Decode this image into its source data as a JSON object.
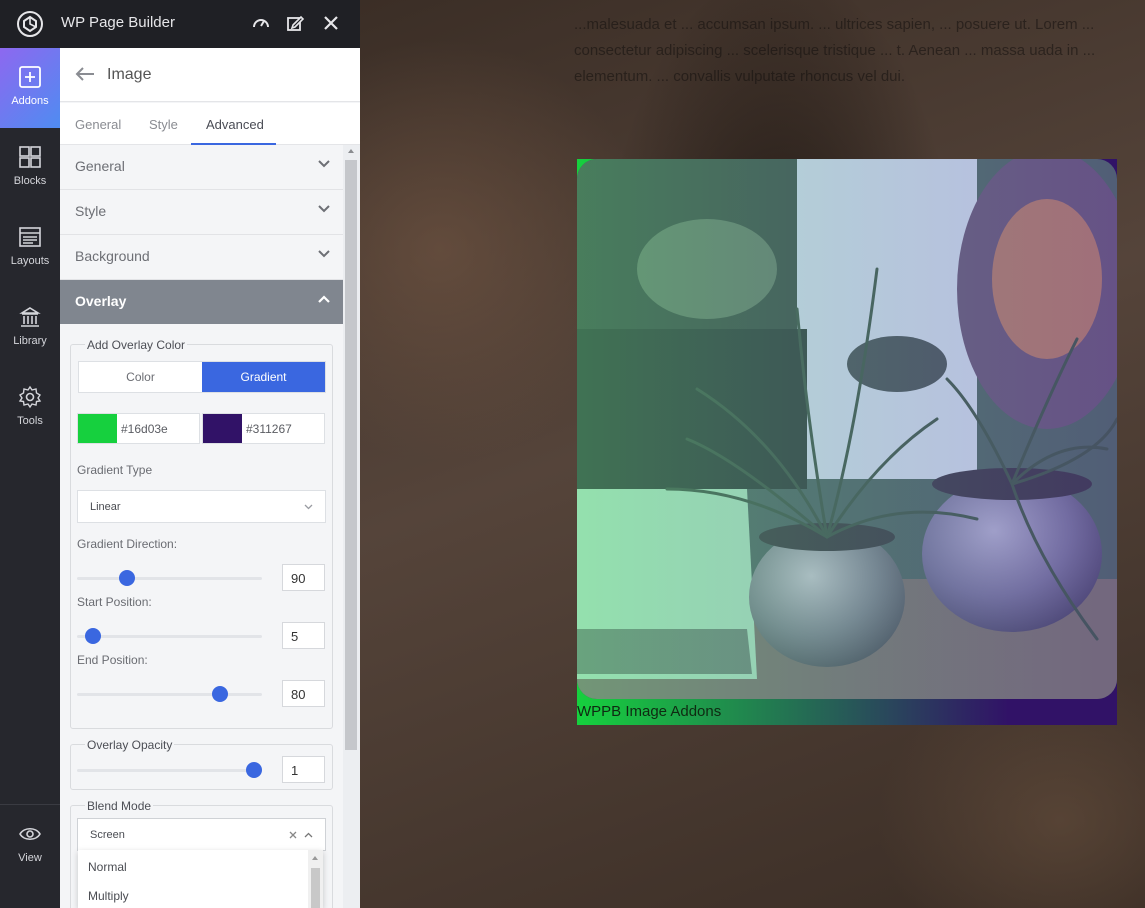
{
  "app": {
    "title": "WP Page Builder"
  },
  "rail": {
    "items": [
      {
        "label": "Addons",
        "icon": "plus-square-icon"
      },
      {
        "label": "Blocks",
        "icon": "blocks-grid-icon"
      },
      {
        "label": "Layouts",
        "icon": "layouts-icon"
      },
      {
        "label": "Library",
        "icon": "library-icon"
      },
      {
        "label": "Tools",
        "icon": "gear-icon"
      }
    ],
    "view": {
      "label": "View",
      "icon": "eye-icon"
    }
  },
  "panel": {
    "title": "Image",
    "tabs": [
      {
        "label": "General"
      },
      {
        "label": "Style"
      },
      {
        "label": "Advanced"
      }
    ],
    "accordions": [
      {
        "label": "General"
      },
      {
        "label": "Style"
      },
      {
        "label": "Background"
      },
      {
        "label": "Overlay"
      }
    ],
    "overlay": {
      "add_color_label": "Add Overlay Color",
      "mode_color": "Color",
      "mode_gradient": "Gradient",
      "color1": "#16d03e",
      "color2": "#311267",
      "gradient_type_label": "Gradient Type",
      "gradient_type_value": "Linear",
      "direction_label": "Gradient Direction:",
      "direction_value": "90",
      "start_label": "Start Position:",
      "start_value": "5",
      "end_label": "End Position:",
      "end_value": "80",
      "opacity_label": "Overlay Opacity",
      "opacity_value": "1",
      "blend_label": "Blend Mode",
      "blend_value": "Screen",
      "blend_options": [
        "Normal",
        "Multiply"
      ]
    }
  },
  "canvas": {
    "bg_text": "...malesuada et ... accumsan ipsum. ... ultrices sapien, ... posuere ut. Lorem ... consectetur adipiscing ... scelerisque tristique ... t. Aenean ... massa uada in ... elementum. ... convallis vulputate rhoncus vel dui.",
    "caption": "WPPB Image Addons"
  }
}
